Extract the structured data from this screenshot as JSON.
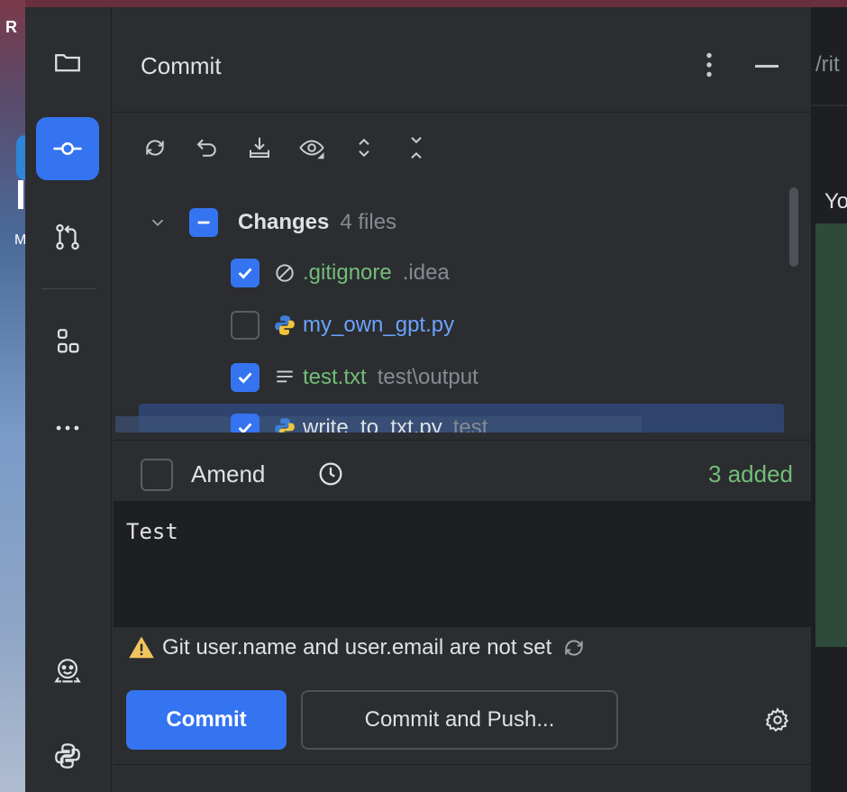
{
  "desktop": {
    "letter_top": "R",
    "letter_mid": "M"
  },
  "toolstrip": {
    "items": [
      {
        "name": "project",
        "icon": "folder-icon"
      },
      {
        "name": "commit",
        "icon": "commit-icon",
        "active": true
      },
      {
        "name": "pull-requests",
        "icon": "pull-request-icon"
      },
      {
        "name": "structure",
        "icon": "structure-icon"
      },
      {
        "name": "more",
        "icon": "more-horizontal-icon"
      },
      {
        "name": "ai-assistant",
        "icon": "robot-icon"
      },
      {
        "name": "python-packages",
        "icon": "python-icon"
      }
    ]
  },
  "panel": {
    "title": "Commit",
    "toolbar": [
      "refresh-icon",
      "rollback-icon",
      "shelve-icon",
      "show-diff-icon",
      "expand-all-icon",
      "collapse-all-icon"
    ]
  },
  "changes": {
    "group_label": "Changes",
    "group_count": "4 files",
    "files": [
      {
        "name": ".gitignore",
        "path": ".idea",
        "checked": true,
        "color": "#73bd79",
        "icon": "ignored-icon"
      },
      {
        "name": "my_own_gpt.py",
        "path": "",
        "checked": false,
        "color": "#6aa3ff",
        "icon": "python-file-icon"
      },
      {
        "name": "test.txt",
        "path": "test\\output",
        "checked": true,
        "color": "#73bd79",
        "icon": "text-file-icon"
      },
      {
        "name": "write_to_txt.py",
        "path": "test",
        "checked": true,
        "color": "#73bd79",
        "icon": "python-file-icon"
      }
    ]
  },
  "amend": {
    "label": "Amend",
    "status": "3 added"
  },
  "commit_message": "Test",
  "warning": "Git user.name and user.email are not set",
  "buttons": {
    "commit": "Commit",
    "commit_push": "Commit and Push..."
  },
  "editor": {
    "tab_fragment": "/rit",
    "text_fragment": "Yo"
  }
}
